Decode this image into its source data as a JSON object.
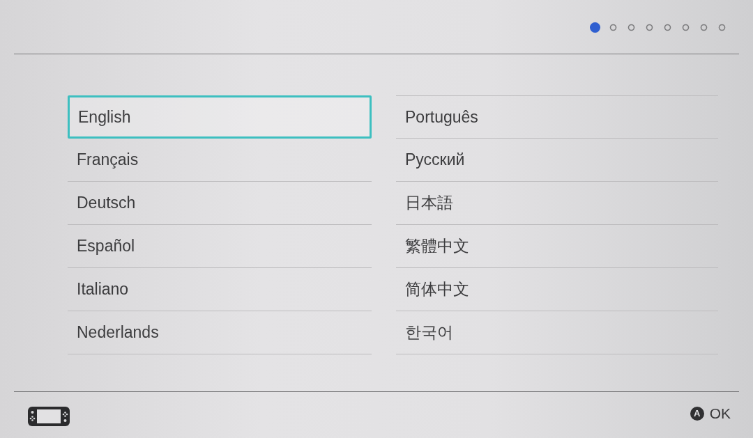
{
  "header": {
    "page_dots": [
      {
        "selected": true
      },
      {
        "selected": false
      },
      {
        "selected": false
      },
      {
        "selected": false
      },
      {
        "selected": false
      },
      {
        "selected": false
      },
      {
        "selected": false
      },
      {
        "selected": false
      }
    ]
  },
  "languages": [
    {
      "label": "English",
      "selected": true
    },
    {
      "label": "Français",
      "selected": false
    },
    {
      "label": "Deutsch",
      "selected": false
    },
    {
      "label": "Español",
      "selected": false
    },
    {
      "label": "Italiano",
      "selected": false
    },
    {
      "label": "Nederlands",
      "selected": false
    },
    {
      "label": "Português",
      "selected": false
    },
    {
      "label": "Русский",
      "selected": false
    },
    {
      "label": "日本語",
      "selected": false
    },
    {
      "label": "繁體中文",
      "selected": false
    },
    {
      "label": "简体中文",
      "selected": false
    },
    {
      "label": "한국어",
      "selected": false
    }
  ],
  "footer": {
    "ok_button": {
      "glyph": "A",
      "label": "OK"
    }
  }
}
